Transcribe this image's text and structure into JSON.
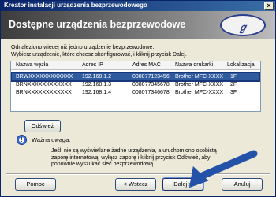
{
  "window": {
    "title": "Kreator instalacji urządzenia bezprzewodowego",
    "close_glyph": "×"
  },
  "banner": {
    "heading": "Dostępne urządzenia bezprzewodowe",
    "logo_glyph": "ℊ"
  },
  "intro": {
    "line1": "Odnaleziono więcej niż jedno urządzenie bezprzewodowe.",
    "line2": "Wybierz urządzenie, które chcesz skonfigurować, i kliknij przycisk Dalej."
  },
  "table": {
    "columns": [
      "Nazwa węzła",
      "Adres IP",
      "Adres MAC",
      "Nazwa drukarki",
      "Lokalizacja"
    ],
    "rows": [
      {
        "node": "BRWXXXXXXXXXXXX",
        "ip": "192.168.1.2",
        "mac": "008077123456",
        "printer": "Brother MFC-XXXX",
        "location": "1F"
      },
      {
        "node": "BRNXXXXXXXXXXXX",
        "ip": "192.168.1.3",
        "mac": "008077345678",
        "printer": "Brother MFC-XXXX",
        "location": "2F"
      },
      {
        "node": "BRNXXXXXXXXXXXX",
        "ip": "192.168.1.4",
        "mac": "008077346678",
        "printer": "Brother MFC-XXXX",
        "location": "3F"
      }
    ]
  },
  "refresh_button": "Odśwież",
  "warning": {
    "icon_glyph": "!",
    "title": "Ważna uwaga:",
    "line1": "Jeśli nie są wyświetlane żadne urządzenia, a uruchomiono osobistą",
    "line2": "zaporę internetową, wyłącz zaporę i kliknij przycisk Odśwież, aby",
    "line3": "ponownie wyszukać sieć bezprzewodową."
  },
  "footer": {
    "help": "Pomoc",
    "back": "< Wstecz",
    "next": "Dalej >",
    "cancel": "Anuluj"
  },
  "colors": {
    "selection": "#2f5b9e",
    "arrow": "#2452a8"
  }
}
